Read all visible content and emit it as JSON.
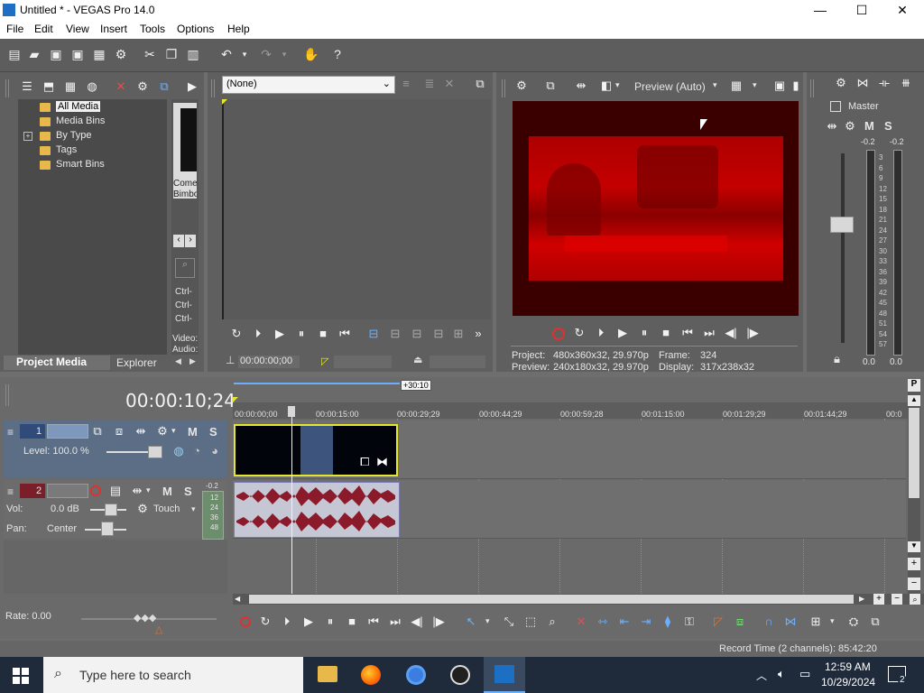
{
  "window": {
    "title": "Untitled * - VEGAS Pro 14.0",
    "minimize": "—",
    "maximize": "☐",
    "close": "✕"
  },
  "menu": [
    "File",
    "Edit",
    "View",
    "Insert",
    "Tools",
    "Options",
    "Help"
  ],
  "project_media": {
    "tree": [
      "All Media",
      "Media Bins",
      "By Type",
      "Tags",
      "Smart Bins"
    ],
    "thumb_caption": "Come Bimbo",
    "shortcuts": [
      "Ctrl-",
      "Ctrl-",
      "Ctrl-"
    ],
    "details": [
      "Video:",
      "Audio:"
    ],
    "tabs": [
      "Project Media",
      "Explorer"
    ]
  },
  "trimmer": {
    "dropdown": "(None)",
    "time": "00:00:00;00"
  },
  "preview": {
    "mode": "Preview (Auto)",
    "project_label": "Project:",
    "project_value": "480x360x32, 29.970p",
    "preview_label": "Preview:",
    "preview_value": "240x180x32, 29.970p",
    "frame_label": "Frame:",
    "frame_value": "324",
    "display_label": "Display:",
    "display_value": "317x238x32",
    "frame_color": "#cc0000"
  },
  "master": {
    "label": "Master",
    "peak_left": "-0.2",
    "peak_right": "-0.2",
    "scale": [
      "3",
      "6",
      "9",
      "12",
      "15",
      "18",
      "21",
      "24",
      "27",
      "30",
      "33",
      "36",
      "39",
      "42",
      "45",
      "48",
      "51",
      "54",
      "57"
    ],
    "value_left": "0.0",
    "value_right": "0.0"
  },
  "timeline": {
    "timecode": "00:00:10;24",
    "region_length": "+30:10",
    "ruler": [
      "00:00:00;00",
      "00:00:15:00",
      "00:00:29;29",
      "00:00:44;29",
      "00:00:59;28",
      "00:01:15:00",
      "00:01:29;29",
      "00:01:44;29",
      "00:0"
    ],
    "video_track": {
      "number": "1",
      "level_label": "Level: 100.0 %",
      "m": "M",
      "s": "S"
    },
    "audio_track": {
      "number": "2",
      "m": "M",
      "s": "S",
      "meter_top": "-0.2",
      "meter": [
        "12",
        "24",
        "36",
        "48"
      ],
      "vol_label": "Vol:",
      "vol_value": "0.0 dB",
      "pan_label": "Pan:",
      "pan_value": "Center",
      "automation": "Touch"
    },
    "rate": "Rate: 0.00",
    "record_time": "Record Time (2 channels): 85:42:20"
  },
  "taskbar": {
    "search_placeholder": "Type here to search",
    "time": "12:59 AM",
    "date": "10/29/2024",
    "notifications": "2"
  }
}
